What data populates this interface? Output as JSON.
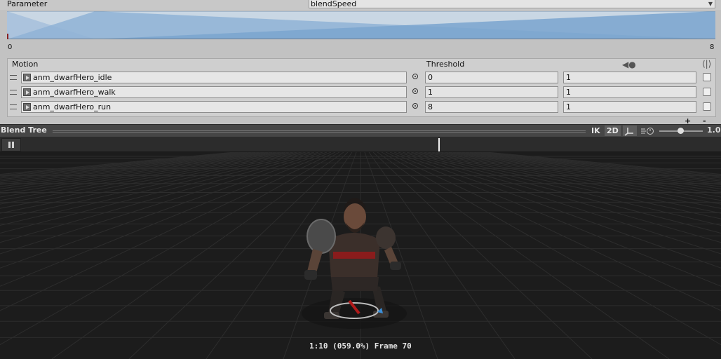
{
  "parameter": {
    "label": "Parameter",
    "value": "blendSpeed"
  },
  "graph": {
    "min_label": "0",
    "max_label": "8",
    "range": [
      0,
      8
    ],
    "thresholds": [
      0,
      1,
      8
    ]
  },
  "motion_list": {
    "header_motion": "Motion",
    "header_threshold": "Threshold",
    "rows": [
      {
        "clip": "anm_dwarfHero_idle",
        "threshold": "0",
        "speed": "1"
      },
      {
        "clip": "anm_dwarfHero_walk",
        "threshold": "1",
        "speed": "1"
      },
      {
        "clip": "anm_dwarfHero_run",
        "threshold": "8",
        "speed": "1"
      }
    ],
    "add_label": "+",
    "remove_label": "-"
  },
  "blend_tree_bar": {
    "title": "Blend Tree",
    "ik_label": "IK",
    "twod_label": "2D",
    "pivot_icon": "pivot-icon",
    "playback_speed_icon": "playback-speed-icon",
    "speed_value": "1.0",
    "speed_fraction": 0.48
  },
  "timeline": {
    "pause_icon": "pause-icon",
    "playhead_fraction": 0.608
  },
  "viewport": {
    "frame_info": "1:10 (059.0%) Frame 70",
    "subject": "dwarf-hero-character"
  },
  "colors": {
    "graph_fill": "#8fb3d6",
    "viewport_bg": "#1c1c1c",
    "toolbar_bg": "#464646"
  }
}
